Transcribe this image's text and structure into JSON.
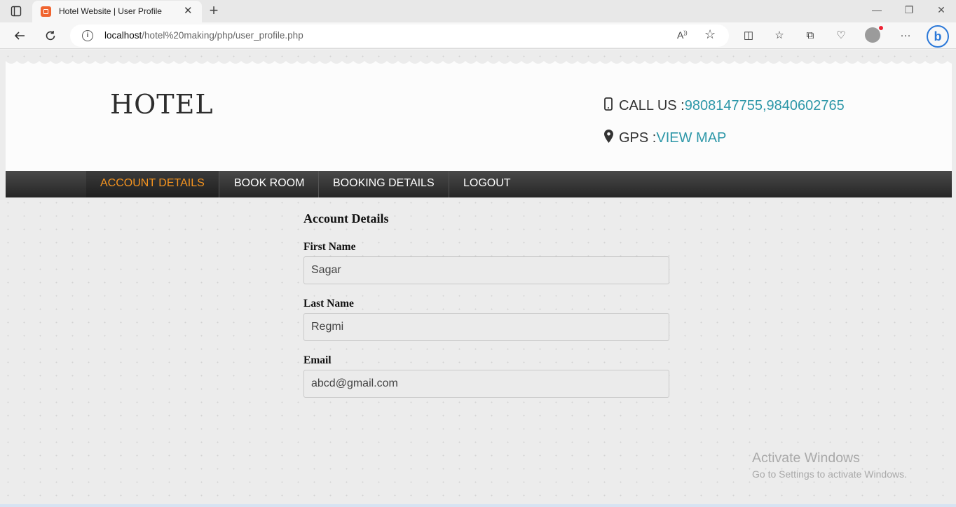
{
  "browser": {
    "tab_title": "Hotel Website | User Profile",
    "url_host": "localhost",
    "url_path": "/hotel%20making/php/user_profile.php",
    "bing_label": "b"
  },
  "site": {
    "logo": "HOTEL",
    "call_label": "CALL US : ",
    "call_numbers": "9808147755,9840602765",
    "gps_label": "GPS : ",
    "gps_link": "VIEW MAP",
    "accent_color": "#2d97a8",
    "active_nav_color": "#f6941f"
  },
  "nav": {
    "items": [
      {
        "label": "ACCOUNT DETAILS",
        "active": true
      },
      {
        "label": "BOOK ROOM",
        "active": false
      },
      {
        "label": "BOOKING DETAILS",
        "active": false
      },
      {
        "label": "LOGOUT",
        "active": false
      }
    ]
  },
  "account": {
    "heading": "Account Details",
    "first_name_label": "First Name",
    "first_name": "Sagar",
    "last_name_label": "Last Name",
    "last_name": "Regmi",
    "email_label": "Email",
    "email": "abcd@gmail.com"
  },
  "watermark": {
    "line1": "Activate Windows",
    "line2": "Go to Settings to activate Windows."
  }
}
